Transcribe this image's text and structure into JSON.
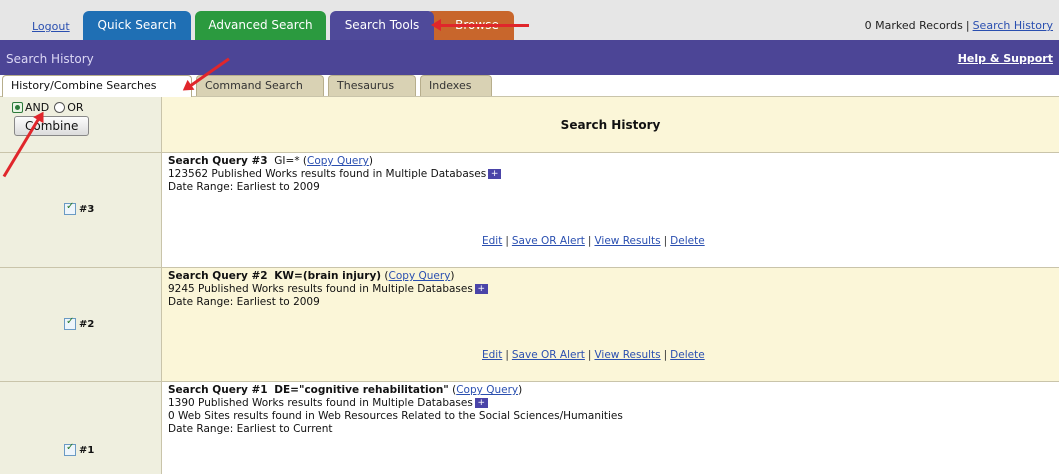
{
  "topnav": {
    "logout": "Logout",
    "tabs": [
      "Quick Search",
      "Advanced Search",
      "Search Tools",
      "Browse"
    ],
    "marked_records": "0 Marked Records",
    "search_history_link": "Search History"
  },
  "band": {
    "title": "Search History",
    "help": "Help & Support"
  },
  "subtabs": [
    "History/Combine Searches",
    "Command Search",
    "Thesaurus",
    "Indexes"
  ],
  "combine": {
    "and": "AND",
    "or": "OR",
    "button": "Combine",
    "header": "Search History"
  },
  "actions": {
    "edit": "Edit",
    "save": "Save OR Alert",
    "view": "View Results",
    "delete": "Delete"
  },
  "queries": [
    {
      "num": "#3",
      "label": "Search Query #3",
      "expr": "GI=*",
      "copy": "Copy Query",
      "lines": [
        "123562 Published Works results found in Multiple Databases"
      ],
      "date": "Date Range: Earliest to 2009"
    },
    {
      "num": "#2",
      "label": "Search Query #2",
      "expr": "KW=(brain injury)",
      "copy": "Copy Query",
      "lines": [
        "9245 Published Works results found in Multiple Databases"
      ],
      "date": "Date Range: Earliest to 2009"
    },
    {
      "num": "#1",
      "label": "Search Query #1",
      "expr": "DE=\"cognitive rehabilitation\"",
      "copy": "Copy Query",
      "lines": [
        "1390 Published Works results found in Multiple Databases",
        "0 Web Sites results found in Web Resources Related to the Social Sciences/Humanities"
      ],
      "date": "Date Range: Earliest to Current"
    }
  ],
  "colors": {
    "purple": "#4c4596",
    "annotation": "#e0262b",
    "tan": "#fbf6d8"
  }
}
